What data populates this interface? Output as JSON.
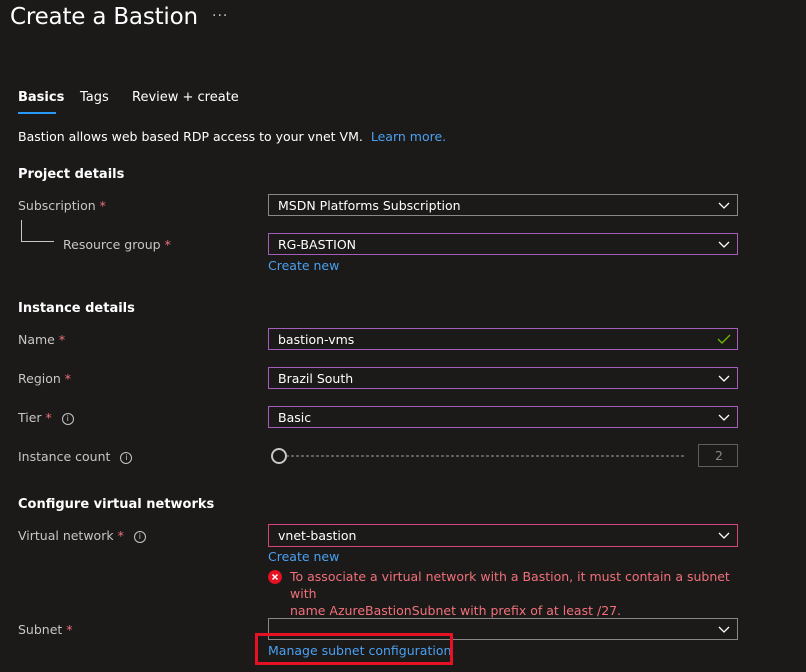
{
  "header": {
    "title": "Create a Bastion",
    "more_label": "···"
  },
  "tabs": [
    {
      "label": "Basics"
    },
    {
      "label": "Tags"
    },
    {
      "label": "Review + create"
    }
  ],
  "intro": {
    "text": "Bastion allows web based RDP access to your vnet VM.",
    "link": "Learn more."
  },
  "project_details": {
    "heading": "Project details",
    "subscription": {
      "label": "Subscription",
      "value": "MSDN Platforms Subscription"
    },
    "resource_group": {
      "label": "Resource group",
      "value": "RG-BASTION",
      "create_new": "Create new"
    }
  },
  "instance_details": {
    "heading": "Instance details",
    "name": {
      "label": "Name",
      "value": "bastion-vms"
    },
    "region": {
      "label": "Region",
      "value": "Brazil South"
    },
    "tier": {
      "label": "Tier",
      "value": "Basic"
    },
    "instance_count": {
      "label": "Instance count",
      "value": "2"
    }
  },
  "virtual_networks": {
    "heading": "Configure virtual networks",
    "virtual_network": {
      "label": "Virtual network",
      "value": "vnet-bastion",
      "create_new": "Create new",
      "error_line1": "To associate a virtual network with a Bastion, it must contain a subnet with",
      "error_line2": "name AzureBastionSubnet with prefix of at least /27."
    },
    "subnet": {
      "label": "Subnet",
      "value": "",
      "manage_link": "Manage subnet configuration"
    }
  },
  "required_mark": "*",
  "colors": {
    "background": "#1b1a19",
    "accent": "#2899f5",
    "error": "#e81123",
    "link": "#4aa0f0"
  }
}
